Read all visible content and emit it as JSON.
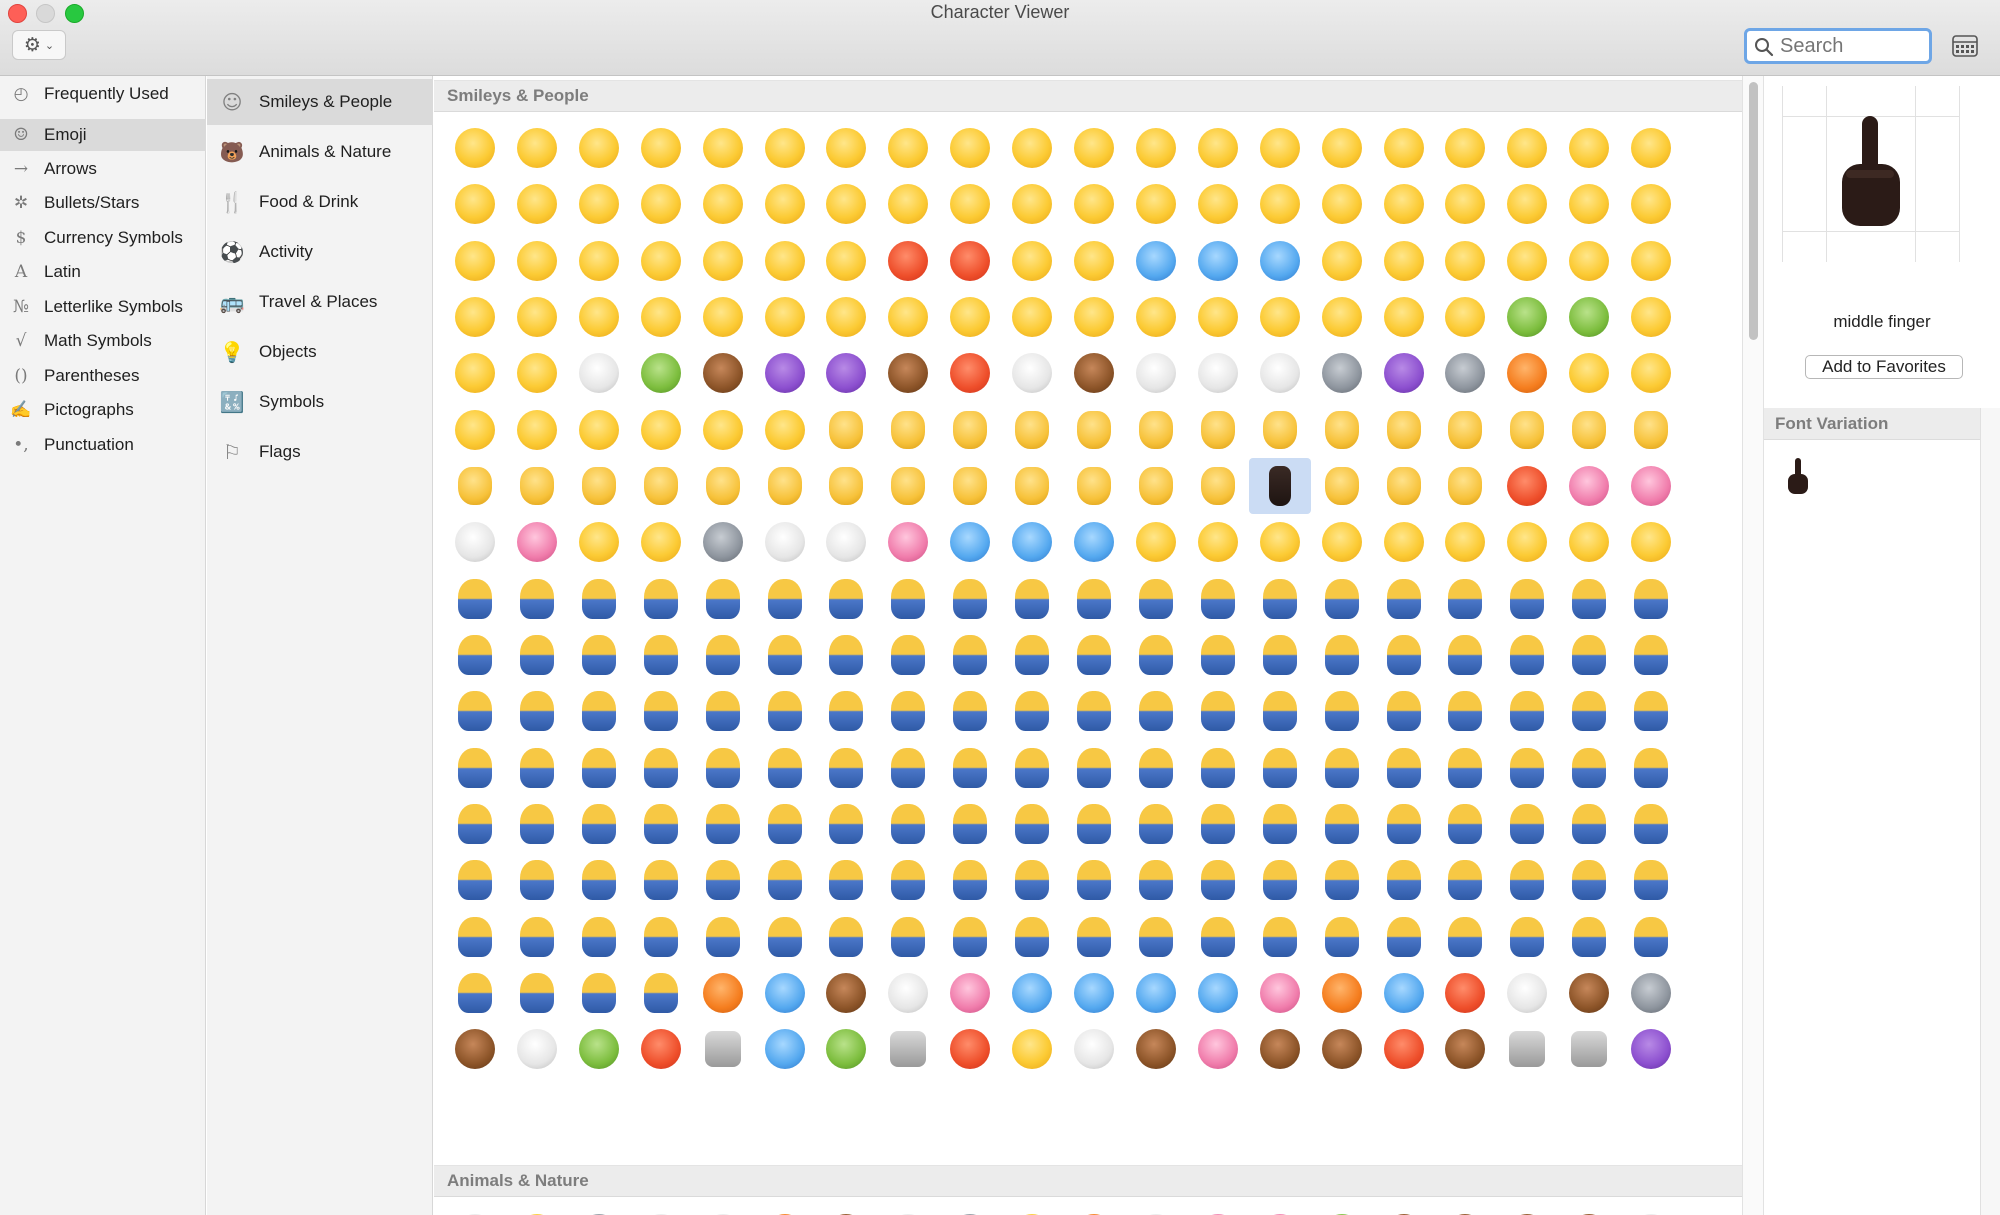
{
  "window": {
    "title": "Character Viewer"
  },
  "toolbar": {
    "search_placeholder": "Search",
    "gear_icon": "gear-icon",
    "grid_icon": "keyboard-grid-icon"
  },
  "categories": [
    {
      "label": "Frequently Used",
      "icon": "◴"
    },
    {
      "label": "Emoji",
      "icon": "☺",
      "selected": true
    },
    {
      "label": "Arrows",
      "icon": "→"
    },
    {
      "label": "Bullets/Stars",
      "icon": "✲"
    },
    {
      "label": "Currency Symbols",
      "icon": "$"
    },
    {
      "label": "Latin",
      "icon": "A"
    },
    {
      "label": "Letterlike Symbols",
      "icon": "№"
    },
    {
      "label": "Math Symbols",
      "icon": "√"
    },
    {
      "label": "Parentheses",
      "icon": "()"
    },
    {
      "label": "Pictographs",
      "icon": "✍"
    },
    {
      "label": "Punctuation",
      "icon": "•,"
    }
  ],
  "subcategories": [
    {
      "label": "Smileys & People",
      "icon": "☺",
      "selected": true
    },
    {
      "label": "Animals & Nature",
      "icon": "🐻"
    },
    {
      "label": "Food & Drink",
      "icon": "🍴"
    },
    {
      "label": "Activity",
      "icon": "⚽"
    },
    {
      "label": "Travel & Places",
      "icon": "🚌"
    },
    {
      "label": "Objects",
      "icon": "💡"
    },
    {
      "label": "Symbols",
      "icon": "🔣"
    },
    {
      "label": "Flags",
      "icon": "⚐"
    }
  ],
  "sections": [
    {
      "title": "Smileys & People"
    },
    {
      "title": "Animals & Nature"
    }
  ],
  "selected": {
    "name": "middle finger",
    "add_to_favorites_label": "Add to Favorites",
    "font_variation_label": "Font Variation"
  }
}
